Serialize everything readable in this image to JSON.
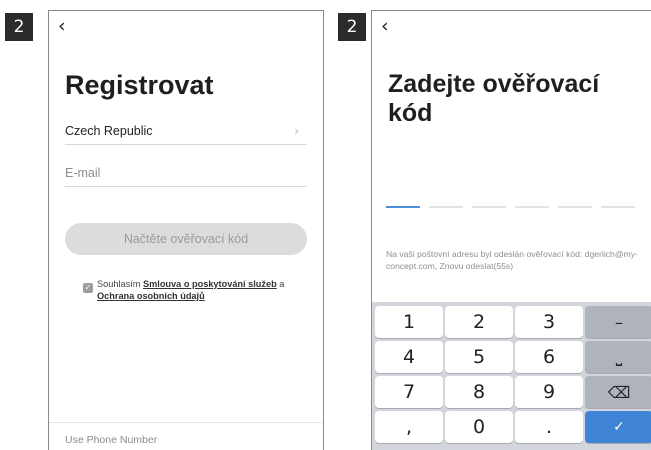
{
  "left": {
    "step": "2",
    "back_icon": "‹",
    "title": "Registrovat",
    "country": "Czech Republic",
    "country_chevron": "›",
    "email_placeholder": "E-mail",
    "get_code_button": "Načtěte ověřovací kód",
    "agree_prefix": "Souhlasím ",
    "agree_link1": "Smlouva o poskytování služeb",
    "agree_mid": " a ",
    "agree_link2": "Ochrana osobních údajů",
    "checkbox_checked": true,
    "use_phone": "Use Phone Number"
  },
  "right": {
    "step": "2",
    "back_icon": "‹",
    "title": "Zadejte ověřovací kód",
    "info_text": "Na vaši poštovní adresu byl odeslán ověřovací kód: dgerlich@my-concept.com, Znovu odeslat(55s)",
    "code_slots": 6,
    "keypad": {
      "rows": [
        [
          "1",
          "2",
          "3",
          "–"
        ],
        [
          "4",
          "5",
          "6",
          "⎵"
        ],
        [
          "7",
          "8",
          "9",
          "⌫"
        ],
        [
          ",",
          "0",
          ".",
          "✓"
        ]
      ]
    }
  }
}
